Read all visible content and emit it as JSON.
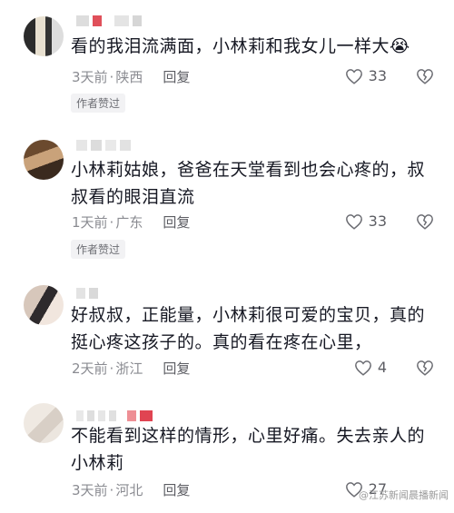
{
  "comments": [
    {
      "text": "看的我泪流满面，小林莉和我女儿一样大😭",
      "time": "3天前",
      "location": "陕西",
      "reply": "回复",
      "likes": "33",
      "badge": "作者赞过"
    },
    {
      "text": "小林莉姑娘，爸爸在天堂看到也会心疼的，叔叔看的眼泪直流",
      "time": "1天前",
      "location": "广东",
      "reply": "回复",
      "likes": "33",
      "badge": "作者赞过"
    },
    {
      "text": "好叔叔，正能量，小林莉很可爱的宝贝，真的挺心疼这孩子的。真的看在疼在心里，",
      "time": "2天前",
      "location": "浙江",
      "reply": "回复",
      "likes": "4",
      "badge": ""
    },
    {
      "text": "不能看到这样的情形，心里好痛。失去亲人的小林莉",
      "time": "3天前",
      "location": "河北",
      "reply": "回复",
      "likes": "27",
      "badge": ""
    }
  ],
  "separator": "·",
  "icons": {
    "like": "heart-outline-icon",
    "dislike": "broken-heart-outline-icon"
  },
  "watermark": "@江苏新闻晨播新闻"
}
